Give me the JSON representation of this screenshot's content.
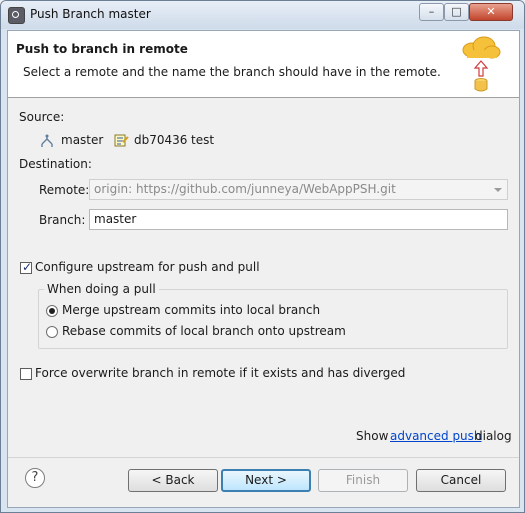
{
  "window": {
    "title": "Push Branch master",
    "controls": {
      "minimize": "–",
      "maximize": "□",
      "close": "✕"
    }
  },
  "header": {
    "title": "Push to branch in remote",
    "description": "Select a remote and the name the branch should have in the remote."
  },
  "source": {
    "label": "Source:",
    "branch": "master",
    "commit_id": "db70436",
    "commit_message": "test"
  },
  "destination": {
    "label": "Destination:",
    "remote_label": "Remote:",
    "remote_value": "origin: https://github.com/junneya/WebAppPSH.git",
    "branch_label": "Branch:",
    "branch_value": "master"
  },
  "upstream": {
    "checkbox_label": "Configure upstream for push and pull",
    "checked": true,
    "group_title": "When doing a pull",
    "option_merge": "Merge upstream commits into local branch",
    "option_rebase": "Rebase commits of local branch onto upstream",
    "selected": "merge"
  },
  "force": {
    "checkbox_label": "Force overwrite branch in remote if it exists and has diverged",
    "checked": false
  },
  "advanced": {
    "prefix": "Show",
    "link": "advanced push",
    "suffix": "dialog"
  },
  "buttons": {
    "help": "?",
    "back": "< Back",
    "next": "Next >",
    "finish": "Finish",
    "cancel": "Cancel"
  },
  "colors": {
    "link": "#0044cc",
    "default_button_border": "#3c7fb1",
    "cloud": "#f6c13a"
  },
  "icons": {
    "branch": "branch-icon",
    "commit": "commit-icon",
    "push_to_cloud": "push-cloud-icon"
  }
}
